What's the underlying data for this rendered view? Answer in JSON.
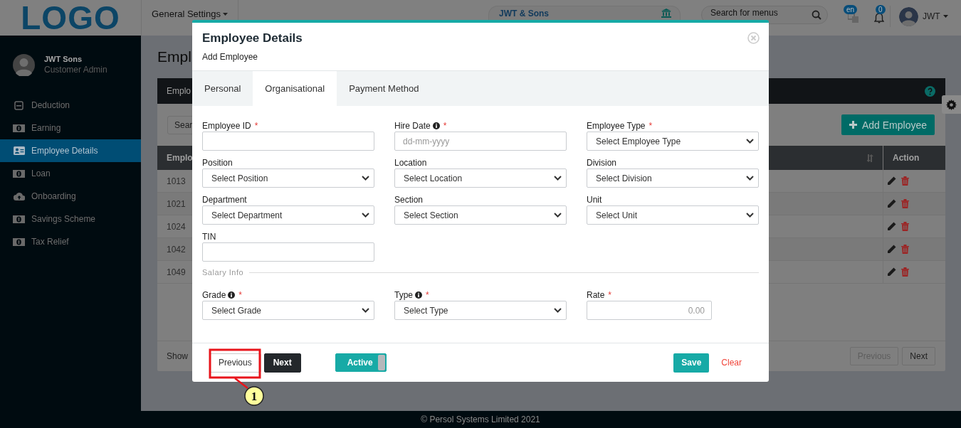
{
  "header": {
    "logo": "LOGO",
    "menu": "General Settings",
    "organization": "JWT & Sons",
    "search": {
      "placeholder": "Search for menus"
    },
    "language": "en",
    "notifications": "0",
    "user": "JWT"
  },
  "sidebar": {
    "user": {
      "name": "JWT Sons",
      "role": "Customer Admin"
    },
    "items": [
      {
        "label": "Deduction",
        "selected": false
      },
      {
        "label": "Earning",
        "selected": false
      },
      {
        "label": "Employee Details",
        "selected": true
      },
      {
        "label": "Loan",
        "selected": false
      },
      {
        "label": "Onboarding",
        "selected": false
      },
      {
        "label": "Savings Scheme",
        "selected": false
      },
      {
        "label": "Tax Relief",
        "selected": false
      }
    ]
  },
  "page": {
    "title": "Empl",
    "card_title": "Emplo",
    "search": {
      "placeholder": "Sear"
    },
    "add_button": "Add Employee",
    "table": {
      "columns": [
        "Emplo",
        "Action"
      ],
      "rows": [
        {
          "cells": [
            "1013"
          ]
        },
        {
          "cells": [
            "1021"
          ]
        },
        {
          "cells": [
            "1024"
          ]
        },
        {
          "cells": [
            "1042"
          ]
        },
        {
          "cells": [
            "1049"
          ]
        }
      ]
    },
    "show_label": "Show",
    "pagination": [
      {
        "label": "Previous",
        "disabled": true
      },
      {
        "label": "Next",
        "disabled": false
      }
    ]
  },
  "modal": {
    "title": "Employee Details",
    "subtitle": "Add Employee",
    "tabs": [
      {
        "label": "Personal",
        "selected": false
      },
      {
        "label": "Organisational",
        "selected": true
      },
      {
        "label": "Payment Method",
        "selected": false
      }
    ],
    "fields": [
      {
        "label": "Employee ID",
        "kind": "input",
        "info": false,
        "required_mark": "*"
      },
      {
        "label": "Hire Date",
        "kind": "input",
        "info": true,
        "required_mark": "*",
        "placeholder": "dd-mm-yyyy"
      },
      {
        "label": "Employee Type",
        "kind": "select",
        "info": false,
        "required_mark": "*",
        "value": "Select Employee Type"
      },
      {
        "label": "Position",
        "kind": "select",
        "info": false,
        "value": "Select Position"
      },
      {
        "label": "Location",
        "kind": "select",
        "info": false,
        "value": "Select Location"
      },
      {
        "label": "Division",
        "kind": "select",
        "info": false,
        "value": "Select Division"
      },
      {
        "label": "Department",
        "kind": "select",
        "info": false,
        "value": "Select Department"
      },
      {
        "label": "Section",
        "kind": "select",
        "info": false,
        "value": "Select Section"
      },
      {
        "label": "Unit",
        "kind": "select",
        "info": false,
        "value": "Select Unit"
      },
      {
        "label": "TIN",
        "kind": "input",
        "info": false
      }
    ],
    "section": "Salary Info",
    "salary_fields": [
      {
        "label": "Grade",
        "kind": "select",
        "info": true,
        "required_mark": "*",
        "value": "Select Grade"
      },
      {
        "label": "Type",
        "kind": "select",
        "info": true,
        "required_mark": "*",
        "value": "Select Type"
      },
      {
        "label": "Rate",
        "kind": "input",
        "info": false,
        "required_mark": "*",
        "placeholder": "0.00"
      }
    ],
    "nav_buttons": [
      {
        "label": "Previous",
        "kind": "secondary"
      },
      {
        "label": "Next",
        "kind": "dark"
      }
    ],
    "toggle": {
      "label": "Active",
      "on": true
    },
    "save": "Save",
    "clear": "Clear"
  },
  "annotation": {
    "number": "1"
  },
  "footer": {
    "copyright": "© Persol Systems Limited 2021"
  }
}
